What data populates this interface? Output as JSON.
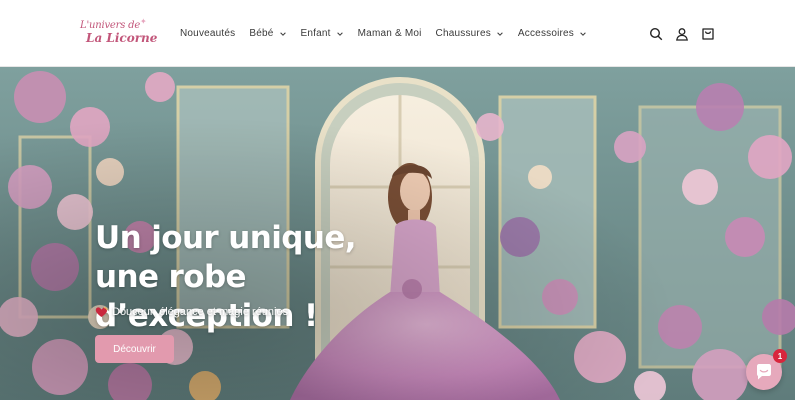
{
  "header": {
    "logo": {
      "line1": "L'univers de",
      "line2": "La Licorne"
    },
    "nav": [
      {
        "label": "Nouveautés",
        "has_dropdown": false
      },
      {
        "label": "Bébé",
        "has_dropdown": true
      },
      {
        "label": "Enfant",
        "has_dropdown": true
      },
      {
        "label": "Maman & Moi",
        "has_dropdown": false
      },
      {
        "label": "Chaussures",
        "has_dropdown": true
      },
      {
        "label": "Accessoires",
        "has_dropdown": true
      }
    ],
    "icons": [
      "search-icon",
      "account-icon",
      "cart-icon"
    ]
  },
  "hero": {
    "title": "Un jour unique, une robe d’exception !",
    "subtitle": "Douceur, élégance et magie réunies",
    "subtitle_icon": "heart-icon",
    "button_label": "Découvrir"
  },
  "chat": {
    "icon": "chat-icon",
    "badge": "1"
  },
  "colors": {
    "brand_pink": "#c2567a",
    "button_pink": "#e29aae",
    "badge_red": "#d8263d",
    "nav_text": "#3a3a3a"
  }
}
